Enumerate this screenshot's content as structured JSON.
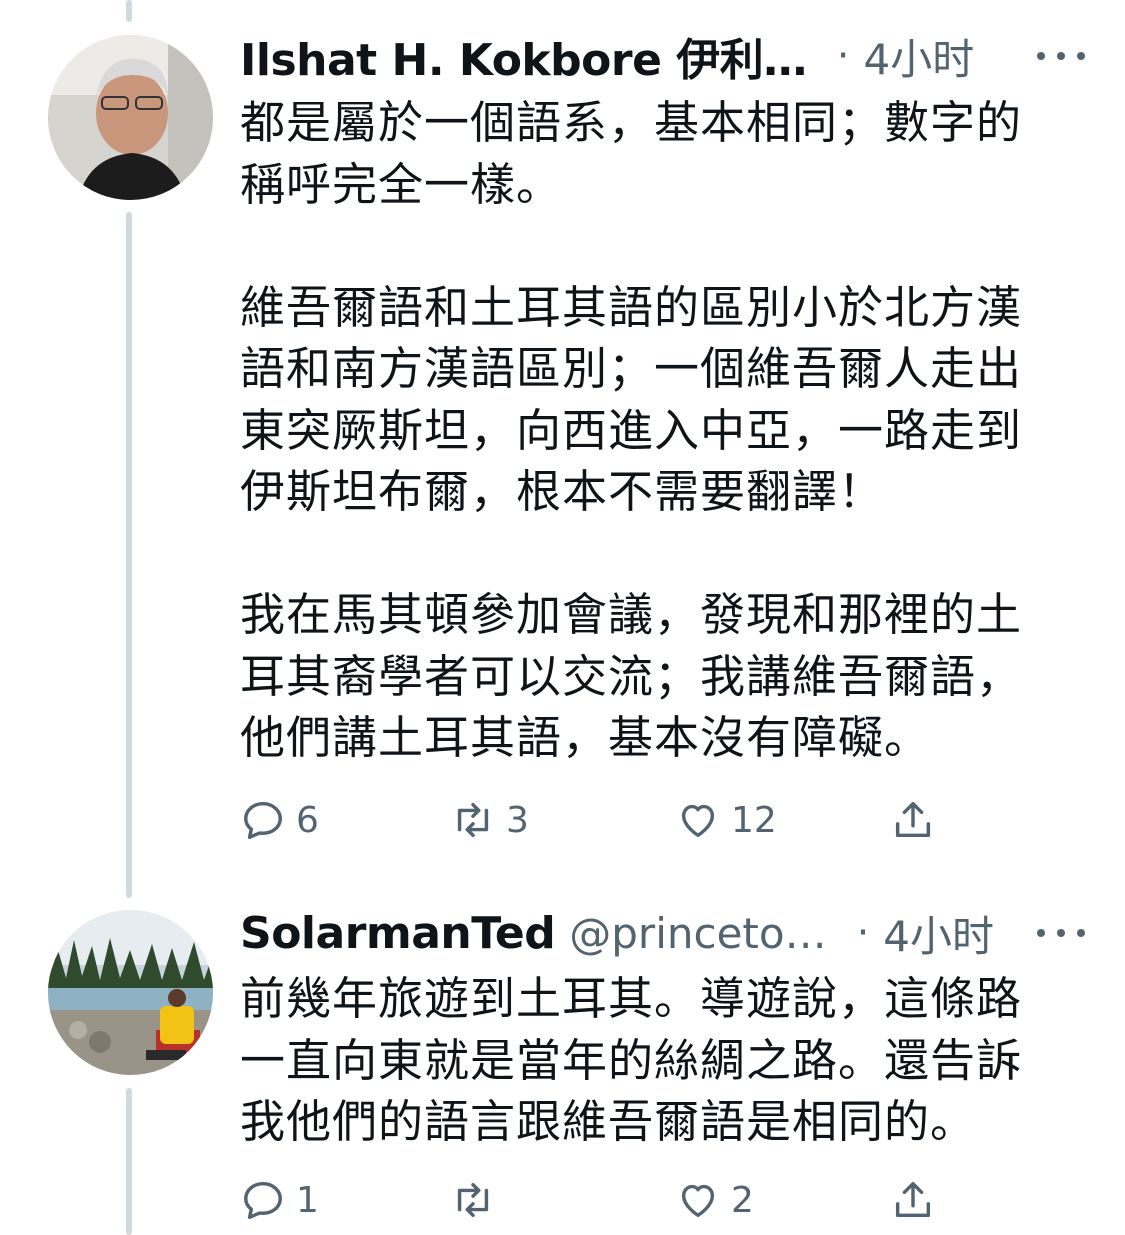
{
  "tweets": [
    {
      "author_name": "Ilshat H. Kokbore 伊利…",
      "author_handle": "",
      "separator": "·",
      "time": "4小时",
      "body": "都是屬於一個語系，基本相同；數字的\n稱呼完全一樣。\n\n維吾爾語和土耳其語的區別小於北方漢\n語和南方漢語區別；一個維吾爾人走出\n東突厥斯坦，向西進入中亞，一路走到\n伊斯坦布爾，根本不需要翻譯！\n\n我在馬其頓參加會議，發現和那裡的土\n耳其裔學者可以交流；我講維吾爾語，\n他們講土耳其語，基本沒有障礙。",
      "replies": "6",
      "retweets": "3",
      "likes": "12"
    },
    {
      "author_name": "SolarmanTed",
      "author_handle": "@princeto…",
      "separator": "·",
      "time": "4小时",
      "body": "前幾年旅遊到土耳其。導遊說，這條路\n一直向東就是當年的絲綢之路。還告訴\n我他們的語言跟維吾爾語是相同的。",
      "replies": "1",
      "retweets": "",
      "likes": "2"
    }
  ],
  "icons": {
    "reply": "reply-icon",
    "retweet": "retweet-icon",
    "like": "heart-icon",
    "share": "share-icon",
    "more": "more-icon"
  },
  "colors": {
    "text": "#0f1419",
    "secondary": "#536471",
    "thread_line": "#cfd9de"
  }
}
